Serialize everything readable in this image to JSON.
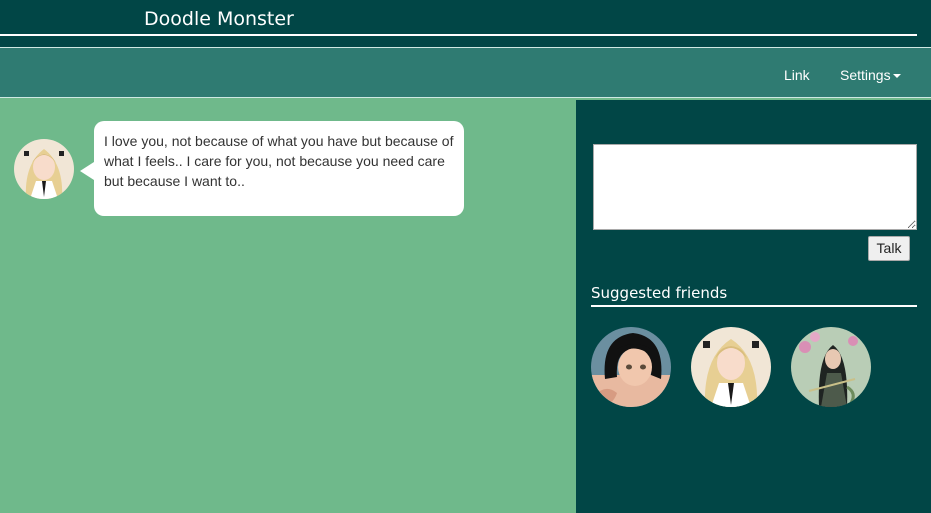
{
  "header": {
    "brand": "Doodle Monster"
  },
  "nav": {
    "items": [
      {
        "label": "Link"
      },
      {
        "label": "Settings"
      }
    ]
  },
  "chat": {
    "message": "I love you, not because of what you have but because of what I feels.. I care for you, not because you need care but because I want to.."
  },
  "sidebar": {
    "talk_value": "",
    "talk_button": "Talk",
    "suggested_title": "Suggested friends"
  },
  "colors": {
    "header_bg": "#014646",
    "nav_bg": "#2f7b72",
    "main_bg": "#6fb98b",
    "sidebar_bg": "#014646"
  }
}
